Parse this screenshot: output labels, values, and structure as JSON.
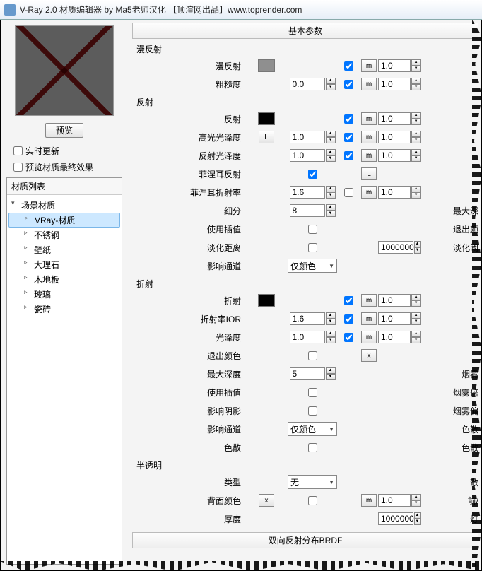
{
  "window": {
    "title": "V-Ray 2.0 材质编辑器 by Ma5老师汉化 【顶渲网出品】www.toprender.com"
  },
  "watermark": "顶渲网",
  "preview": {
    "button": "预览",
    "realtime": "实时更新",
    "final": "预览材质最终效果"
  },
  "matlist": {
    "title": "材质列表",
    "root": "场景材质",
    "items": [
      "VRay-材质",
      "不锈钢",
      "壁纸",
      "大理石",
      "木地板",
      "玻璃",
      "瓷砖"
    ],
    "selected": "VRay-材质"
  },
  "sections": {
    "basic": "基本参数",
    "brdf": "双向反射分布BRDF"
  },
  "groups": {
    "diffuse": "漫反射",
    "reflect": "反射",
    "refract": "折射",
    "trans": "半透明"
  },
  "labels": {
    "diffuse": "漫反射",
    "roughness": "粗糙度",
    "reflect": "反射",
    "hilight": "高光光泽度",
    "reflgloss": "反射光泽度",
    "fresnel": "菲涅耳反射",
    "fresnelIOR": "菲涅耳折射率",
    "subdiv": "细分",
    "interp": "使用插值",
    "dimdist": "淡化距离",
    "affect": "影响通道",
    "refract": "折射",
    "ior": "折射率IOR",
    "gloss": "光泽度",
    "exitcolor": "退出颜色",
    "maxdepth": "最大深度",
    "interp2": "使用插值",
    "shadows": "影响阴影",
    "affect2": "影响通道",
    "disp": "色散",
    "type": "类型",
    "backcolor": "背面颜色",
    "thick": "厚度"
  },
  "values": {
    "roughness": "0.0",
    "hilight": "1.0",
    "reflgloss": "1.0",
    "fresnelIOR": "1.6",
    "subdiv": "8",
    "dimdist": "1000000",
    "affect": "仅颜色",
    "ior": "1.6",
    "gloss": "1.0",
    "maxdepth": "5",
    "affect2": "仅颜色",
    "type": "无",
    "bc_m": "1.0",
    "thick": "1000000",
    "m10": "1.0"
  },
  "tails": {
    "subdiv": "最大深",
    "interp": "退出颜",
    "dimdist": "淡化阈",
    "interp2": "烟雾",
    "shadows": "烟雾倍",
    "affect2": "烟雾偏",
    "disp": "色散",
    "type": "散",
    "backcolor": "前/",
    "thick": "灯"
  },
  "btn": {
    "L": "L",
    "m": "m",
    "x": "x"
  }
}
